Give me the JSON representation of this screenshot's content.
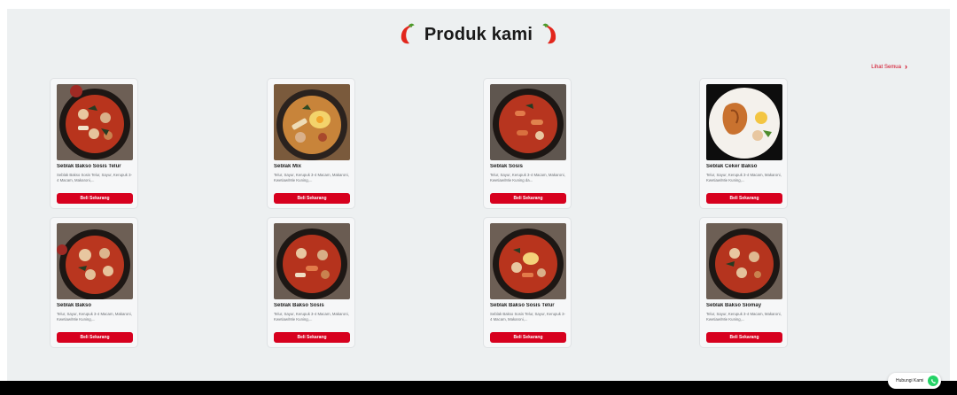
{
  "section": {
    "title": "Produk kami",
    "see_all_label": "Lihat Semua"
  },
  "products": [
    {
      "name": "Seblak Bakso Sosis Telur",
      "desc": "Seblak Bakso Sosis Telur, Sayur, Kerupuk 3-4 Macam, Makaroni,...",
      "button": "Beli Sekarang"
    },
    {
      "name": "Seblak Mix",
      "desc": "Telur, Sayur, Kerupuk 3-4 Macam, Makaroni, Kwetiaw/Mie Kuning,...",
      "button": "Beli Sekarang"
    },
    {
      "name": "Seblak Sosis",
      "desc": "Telur, Sayur, Kerupuk 3-4 Macam, Makaroni, Kwetiaw/Mie Kuning da...",
      "button": "Beli Sekarang"
    },
    {
      "name": "Seblak Ceker Bakso",
      "desc": "Telur, Sayur, Kerupuk 3-4 Macam, Makaroni, Kwetiaw/Mie Kuning,...",
      "button": "Beli Sekarang"
    },
    {
      "name": "Seblak Bakso",
      "desc": "Telur, Sayur, Kerupuk 3-4 Macam, Makaroni, Kwetiaw/Mie Kuning,...",
      "button": "Beli Sekarang"
    },
    {
      "name": "Seblak Bakso Sosis",
      "desc": "Telur, Sayur, Kerupuk 3-4 Macam, Makaroni, Kwetiaw/Mie Kuning,...",
      "button": "Beli Sekarang"
    },
    {
      "name": "Seblak Bakso Sosis Telur",
      "desc": "Seblak Bakso Sosis Telur, Sayur, Kerupuk 3-4 Macam, Makaroni,...",
      "button": "Beli Sekarang"
    },
    {
      "name": "Seblak Bakso Siomay",
      "desc": "Telur, Sayur, Kerupuk 3-4 Macam, Makaroni, Kwetiaw/Mie Kuning,...",
      "button": "Beli Sekarang"
    }
  ],
  "contact": {
    "label": "Hubungi Kami",
    "icon": "whatsapp-icon"
  },
  "colors": {
    "accent": "#d7001e",
    "page_bg": "#edf0f1",
    "footer": "#000000",
    "whatsapp": "#25d366"
  }
}
